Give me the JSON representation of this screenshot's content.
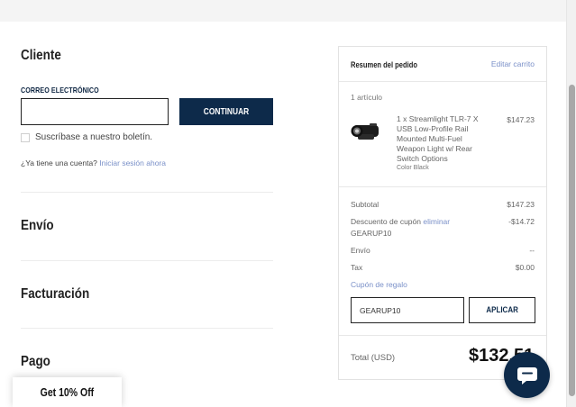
{
  "customer": {
    "title": "Cliente",
    "email_label": "CORREO ELECTRÓNICO",
    "email_value": "",
    "continue_label": "CONTINUAR",
    "newsletter_label": "Suscríbase a nuestro boletín.",
    "account_prompt": "¿Ya tiene una cuenta?",
    "sign_in_link": "Iniciar sesión ahora"
  },
  "sections": {
    "shipping": "Envío",
    "billing": "Facturación",
    "payment": "Pago"
  },
  "promo": {
    "label": "Get 10% Off"
  },
  "summary": {
    "title": "Resumen del pedido",
    "edit_link": "Editar carrito",
    "items_count": "1 artículo",
    "product": {
      "name": "1 x Streamlight TLR-7 X USB Low-Profile Rail Mounted Multi-Fuel Weapon Light w/ Rear Switch Options",
      "variant": "Color Black",
      "price": "$147.23"
    },
    "subtotal_label": "Subtotal",
    "subtotal_value": "$147.23",
    "discount_label": "Descuento de cupón",
    "discount_remove": "eliminar",
    "discount_code": "GEARUP10",
    "discount_value": "-$14.72",
    "shipping_label": "Envío",
    "shipping_value": "--",
    "tax_label": "Tax",
    "tax_value": "$0.00",
    "gift_link": "Cupón de regalo",
    "gift_input_value": "GEARUP10",
    "apply_label": "APLICAR",
    "total_label": "Total (USD)",
    "total_value": "$132.51"
  },
  "colors": {
    "brand_navy": "#0d2a4a",
    "link": "#7a90c8"
  },
  "icons": {
    "chat": "chat-bubble-icon",
    "product": "weapon-light-thumbnail"
  }
}
